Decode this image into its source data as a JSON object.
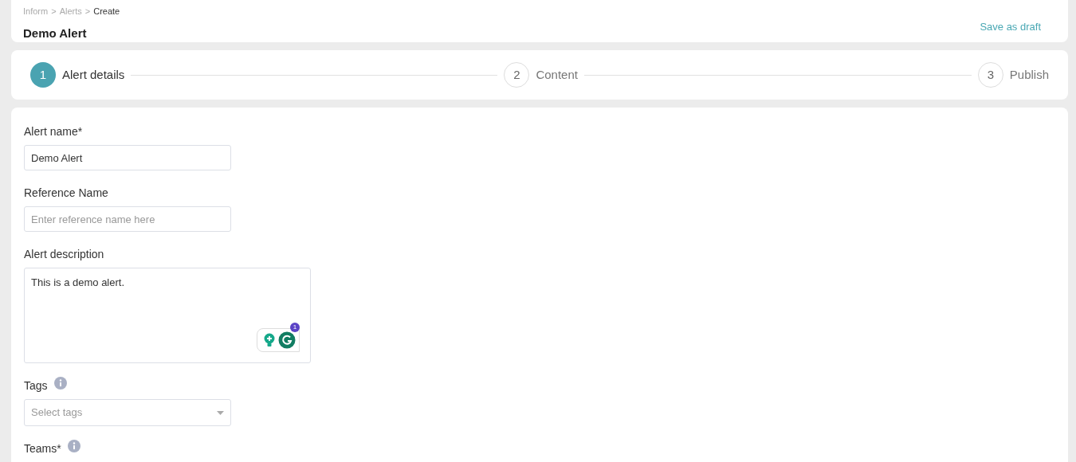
{
  "breadcrumb": [
    {
      "label": "Inform",
      "current": false
    },
    {
      "label": "Alerts",
      "current": false
    },
    {
      "label": "Create",
      "current": true
    }
  ],
  "breadcrumb_separator": ">",
  "title": "Demo Alert",
  "save_draft": "Save as draft",
  "steps": [
    {
      "number": "1",
      "label": "Alert details",
      "selected": true
    },
    {
      "number": "2",
      "label": "Content",
      "selected": false
    },
    {
      "number": "3",
      "label": "Publish",
      "selected": false
    }
  ],
  "fields": [
    {
      "kind": "text",
      "label": "Alert name*",
      "info": false,
      "value": "Demo Alert"
    },
    {
      "kind": "text",
      "label": "Reference Name",
      "info": false,
      "placeholder": "Enter reference name here"
    },
    {
      "kind": "textarea",
      "label": "Alert description",
      "info": false,
      "value": "This is a demo alert.",
      "assistant_badge": "1"
    },
    {
      "kind": "select",
      "label": "Tags",
      "info": true,
      "placeholder": "Select tags"
    },
    {
      "kind": "label",
      "label": "Teams*",
      "info": true
    }
  ]
}
